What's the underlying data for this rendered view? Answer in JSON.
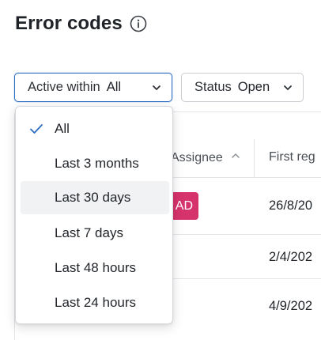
{
  "page": {
    "title": "Error codes"
  },
  "filters": {
    "active_within": {
      "label": "Active within",
      "value": "All"
    },
    "status": {
      "label": "Status",
      "value": "Open"
    }
  },
  "table": {
    "headers": {
      "assignee": "Assignee",
      "first_registered": "First reg"
    },
    "badge": "AD",
    "dates": [
      "26/8/20",
      "2/4/202",
      "4/9/202"
    ]
  },
  "dropdown": {
    "selected": "All",
    "hovered": "Last 30 days",
    "options": [
      "All",
      "Last 3 months",
      "Last 30 days",
      "Last 7 days",
      "Last 48 hours",
      "Last 24 hours"
    ]
  },
  "colors": {
    "accent": "#2c6cc2",
    "badge": "#d6336c",
    "hover": "#f1f2f4",
    "border": "#c9ccd1"
  },
  "icons": {
    "title_info": "info-icon",
    "chip_arrow": "chevron-down-icon",
    "sort": "chevron-up-icon",
    "selected_mark": "checkmark-icon"
  }
}
